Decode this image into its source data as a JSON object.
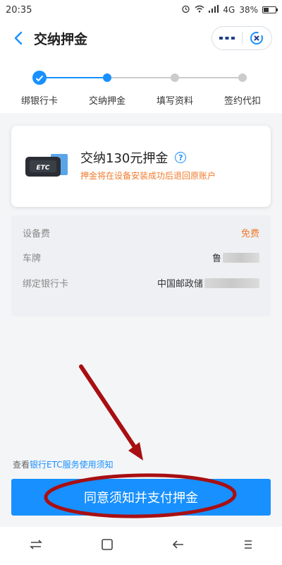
{
  "status_bar": {
    "time": "20:35",
    "network": "4G",
    "battery": "38%"
  },
  "nav": {
    "title": "交纳押金"
  },
  "steps": [
    {
      "label": "绑银行卡",
      "state": "done"
    },
    {
      "label": "交纳押金",
      "state": "active"
    },
    {
      "label": "填写资料",
      "state": "pending"
    },
    {
      "label": "签约代扣",
      "state": "pending"
    }
  ],
  "deposit_card": {
    "etc_label": "ETC",
    "title": "交纳130元押金",
    "note": "押金将在设备安装成功后退回原账户"
  },
  "details": [
    {
      "label": "设备费",
      "value": "免费"
    },
    {
      "label": "车牌",
      "value": "鲁"
    },
    {
      "label": "绑定银行卡",
      "value": "中国邮政储"
    }
  ],
  "agreement": {
    "prefix": "查看",
    "link": "银行ETC服务使用须知"
  },
  "pay_button": {
    "label": "同意须知并支付押金"
  },
  "colors": {
    "primary": "#1890ff",
    "accent": "#f07b2d",
    "annotation": "#a80f12"
  },
  "icons": [
    "back-icon",
    "more-icon",
    "close-mini-program-icon",
    "help-icon",
    "check-icon",
    "recent-apps-icon",
    "home-icon",
    "back-nav-icon",
    "menu-icon"
  ]
}
